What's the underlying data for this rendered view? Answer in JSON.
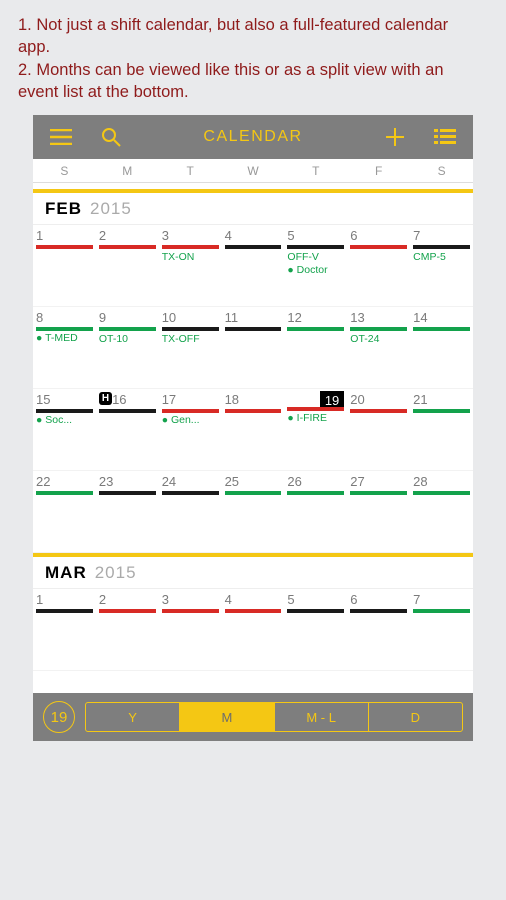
{
  "annotation": {
    "line1": "1. Not just a shift calendar, but also a full-featured calendar app.",
    "line2": "2. Months can be viewed like this or as a split view with an event list at the bottom."
  },
  "toolbar": {
    "title": "CALENDAR"
  },
  "weekdays": [
    "S",
    "M",
    "T",
    "W",
    "T",
    "F",
    "S"
  ],
  "months": {
    "feb": {
      "name": "FEB",
      "year": "2015"
    },
    "mar": {
      "name": "MAR",
      "year": "2015"
    }
  },
  "feb_weeks": [
    [
      {
        "num": "1",
        "bar": "red"
      },
      {
        "num": "2",
        "bar": "red"
      },
      {
        "num": "3",
        "bar": "red",
        "label": "TX-ON"
      },
      {
        "num": "4",
        "bar": "black"
      },
      {
        "num": "5",
        "bar": "black",
        "label": "OFF-V",
        "event": "● Doctor"
      },
      {
        "num": "6",
        "bar": "red"
      },
      {
        "num": "7",
        "bar": "black",
        "label": "CMP-5"
      }
    ],
    [
      {
        "num": "8",
        "bar": "green",
        "event": "● T-MED"
      },
      {
        "num": "9",
        "bar": "green",
        "label": "OT-10"
      },
      {
        "num": "10",
        "bar": "black",
        "label": "TX-OFF"
      },
      {
        "num": "11",
        "bar": "black"
      },
      {
        "num": "12",
        "bar": "green"
      },
      {
        "num": "13",
        "bar": "green",
        "label": "OT-24"
      },
      {
        "num": "14",
        "bar": "green"
      }
    ],
    [
      {
        "num": "15",
        "bar": "black",
        "event": "● Soc..."
      },
      {
        "num": "16",
        "bar": "black",
        "holiday": "H"
      },
      {
        "num": "17",
        "bar": "red",
        "event": "● Gen..."
      },
      {
        "num": "18",
        "bar": "red"
      },
      {
        "num": "19",
        "bar": "red",
        "today": true,
        "event": "● I-FIRE"
      },
      {
        "num": "20",
        "bar": "red"
      },
      {
        "num": "21",
        "bar": "green"
      }
    ],
    [
      {
        "num": "22",
        "bar": "green"
      },
      {
        "num": "23",
        "bar": "black"
      },
      {
        "num": "24",
        "bar": "black"
      },
      {
        "num": "25",
        "bar": "green"
      },
      {
        "num": "26",
        "bar": "green"
      },
      {
        "num": "27",
        "bar": "green"
      },
      {
        "num": "28",
        "bar": "green"
      }
    ]
  ],
  "mar_week": [
    {
      "num": "1",
      "bar": "black"
    },
    {
      "num": "2",
      "bar": "red"
    },
    {
      "num": "3",
      "bar": "red"
    },
    {
      "num": "4",
      "bar": "red"
    },
    {
      "num": "5",
      "bar": "black"
    },
    {
      "num": "6",
      "bar": "black"
    },
    {
      "num": "7",
      "bar": "green"
    }
  ],
  "footer": {
    "today": "19",
    "segments": [
      "Y",
      "M",
      "M - L",
      "D"
    ],
    "active": "M"
  }
}
